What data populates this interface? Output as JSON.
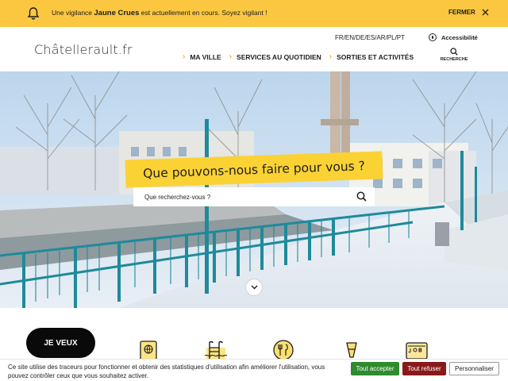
{
  "alert": {
    "prefix": "Une vigilance ",
    "level": "Jaune Crues",
    "suffix": " est actuellement en cours. Soyez vigilant !",
    "close_label": "FERMER"
  },
  "header": {
    "logo": "Châtellerault.fr",
    "languages": "FR/EN/DE/ES/AR/PL/PT",
    "accessibility": "Accessibilité",
    "nav": [
      {
        "label": "MA VILLE"
      },
      {
        "label": "SERVICES AU QUOTIDIEN"
      },
      {
        "label": "SORTIES ET ACTIVITÉS"
      }
    ],
    "search_label": "RECHERCHE"
  },
  "hero": {
    "question": "Que pouvons-nous faire pour vous ?",
    "search_placeholder": "Que recherchez-vous ?"
  },
  "quick_access": {
    "button": "JE VEUX",
    "icons": [
      "passport-icon",
      "pool-icon",
      "restaurant-icon",
      "cocktail-icon",
      "job-icon"
    ]
  },
  "cookie": {
    "text": "Ce site utilise des traceurs pour fonctionner et obtenir des statistiques d'utilisation afin améliorer l'utilisation, vous pouvez contrôler ceux que vous souhaitez activer.",
    "accept": "Tout accepter",
    "refuse": "Tout refuser",
    "customize": "Personnaliser"
  },
  "colors": {
    "alert_bg": "#fbc740",
    "accent_yellow": "#fbd234",
    "accept_green": "#2e8b2e",
    "refuse_red": "#8a1a1a"
  }
}
